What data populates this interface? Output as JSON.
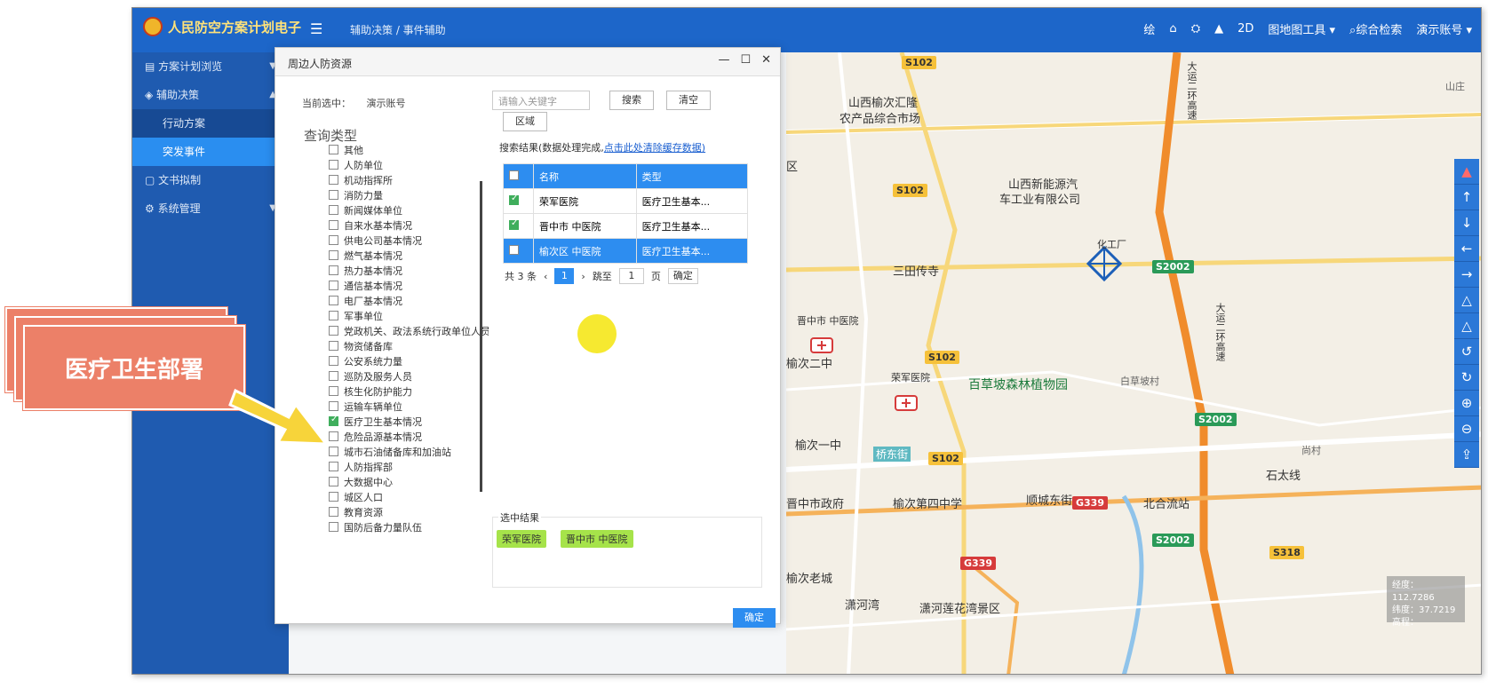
{
  "header": {
    "app_title": "人民防空方案计划电子",
    "breadcrumb": "辅助决策 / 事件辅助",
    "menu_icon": "hamburger-icon",
    "right_items": [
      "绘",
      "⌂",
      "⛭",
      "▲",
      "2D",
      "图地图工具 ▾",
      "⌕综合检索",
      "演示账号 ▾"
    ]
  },
  "sidebar": {
    "items": [
      {
        "label": "方案计划浏览",
        "icon": "doc-icon"
      },
      {
        "label": "辅助决策",
        "icon": "cube-icon"
      },
      {
        "label": "行动方案",
        "icon": ""
      },
      {
        "label": "突发事件",
        "icon": ""
      },
      {
        "label": "文书拟制",
        "icon": "file-icon"
      },
      {
        "label": "系统管理",
        "icon": "gear-icon"
      }
    ]
  },
  "dialog": {
    "title": "周边人防资源",
    "current_label": "当前选中：",
    "current_value": "演示账号",
    "query_type_label": "查询类型",
    "categories": [
      {
        "label": "其他",
        "checked": false
      },
      {
        "label": "人防单位",
        "checked": false
      },
      {
        "label": "机动指挥所",
        "checked": false
      },
      {
        "label": "消防力量",
        "checked": false
      },
      {
        "label": "新闻媒体单位",
        "checked": false
      },
      {
        "label": "自来水基本情况",
        "checked": false
      },
      {
        "label": "供电公司基本情况",
        "checked": false
      },
      {
        "label": "燃气基本情况",
        "checked": false
      },
      {
        "label": "热力基本情况",
        "checked": false
      },
      {
        "label": "通信基本情况",
        "checked": false
      },
      {
        "label": "电厂基本情况",
        "checked": false
      },
      {
        "label": "军事单位",
        "checked": false
      },
      {
        "label": "党政机关、政法系统行政单位人员",
        "checked": false
      },
      {
        "label": "物资储备库",
        "checked": false
      },
      {
        "label": "公安系统力量",
        "checked": false
      },
      {
        "label": "巡防及服务人员",
        "checked": false
      },
      {
        "label": "核生化防护能力",
        "checked": false
      },
      {
        "label": "运输车辆单位",
        "checked": false
      },
      {
        "label": "医疗卫生基本情况",
        "checked": true
      },
      {
        "label": "危险品源基本情况",
        "checked": false
      },
      {
        "label": "城市石油储备库和加油站",
        "checked": false
      },
      {
        "label": "人防指挥部",
        "checked": false
      },
      {
        "label": "大数据中心",
        "checked": false
      },
      {
        "label": "城区人口",
        "checked": false
      },
      {
        "label": "教育资源",
        "checked": false
      },
      {
        "label": "国防后备力量队伍",
        "checked": false
      }
    ],
    "keyword_placeholder": "请输入关键字",
    "search_label": "搜索",
    "clear_label": "清空",
    "area_label": "区域",
    "results_hint": "搜索结果(数据处理完成,",
    "results_link": "点击此处清除缓存数据)",
    "table": {
      "headers": [
        "名称",
        "类型"
      ],
      "rows": [
        {
          "name": "荣军医院",
          "type": "医疗卫生基本...",
          "checked": true,
          "selected": false
        },
        {
          "name": "晋中市 中医院",
          "type": "医疗卫生基本...",
          "checked": true,
          "selected": false
        },
        {
          "name": "榆次区 中医院",
          "type": "医疗卫生基本...",
          "checked": false,
          "selected": true
        }
      ]
    },
    "pager": {
      "total": "共 3 条",
      "current": "1",
      "goto_label": "跳至",
      "goto_value": "1",
      "page_label": "页",
      "confirm_label": "确定"
    },
    "selected_title": "选中结果",
    "selected_tags": [
      "荣军医院",
      "晋中市 中医院"
    ],
    "confirm_label": "确定"
  },
  "map": {
    "labels": [
      {
        "text": "山西榆次汇隆",
        "kind": "poi"
      },
      {
        "text": "农产品综合市场",
        "kind": "poi"
      },
      {
        "text": "山西新能源汽",
        "kind": "poi"
      },
      {
        "text": "车工业有限公司",
        "kind": "poi"
      },
      {
        "text": "化工厂",
        "kind": "poi"
      },
      {
        "text": "三田传寺",
        "kind": "poi"
      },
      {
        "text": "晋中市 中医院",
        "kind": "poi"
      },
      {
        "text": "榆次二中",
        "kind": "poi"
      },
      {
        "text": "荣军医院",
        "kind": "poi"
      },
      {
        "text": "百草坡森林植物园",
        "kind": "park"
      },
      {
        "text": "白草坡村",
        "kind": "poi"
      },
      {
        "text": "榆次一中",
        "kind": "poi"
      },
      {
        "text": "桥东街",
        "kind": "poi"
      },
      {
        "text": "晋中市政府",
        "kind": "poi"
      },
      {
        "text": "榆次第四中学",
        "kind": "poi"
      },
      {
        "text": "顺城东街",
        "kind": "poi"
      },
      {
        "text": "北合流站",
        "kind": "poi"
      },
      {
        "text": "石太线",
        "kind": "poi"
      },
      {
        "text": "尚村",
        "kind": "poi"
      },
      {
        "text": "榆次老城",
        "kind": "poi"
      },
      {
        "text": "潇河湾",
        "kind": "poi"
      },
      {
        "text": "潇河莲花湾景区",
        "kind": "poi"
      },
      {
        "text": "山庄",
        "kind": "poi"
      },
      {
        "text": "区",
        "kind": "poi"
      },
      {
        "text": "大运二环高速",
        "kind": "poi"
      },
      {
        "text": "大运二环高速",
        "kind": "poi"
      }
    ],
    "road_tags": [
      "S102",
      "S102",
      "S102",
      "S102",
      "S2002",
      "S2002",
      "S2002",
      "G339",
      "G339",
      "S318"
    ],
    "coords": [
      "经度：112.7286",
      "纬度：37.7219",
      "高程："
    ],
    "tools": [
      "compass-icon",
      "arrow-up-icon",
      "arrow-down-icon",
      "arrow-left-icon",
      "arrow-right-icon",
      "tilt-up-icon",
      "tilt-down-icon",
      "rotate-left-icon",
      "rotate-right-icon",
      "zoom-in-icon",
      "zoom-out-icon",
      "locate-icon"
    ]
  },
  "callout": {
    "text": "医疗卫生部署"
  },
  "colors": {
    "primary": "#1d66c9",
    "accent": "#2d8df0",
    "banner": "#ec8068",
    "tag": "#a6e34a"
  }
}
